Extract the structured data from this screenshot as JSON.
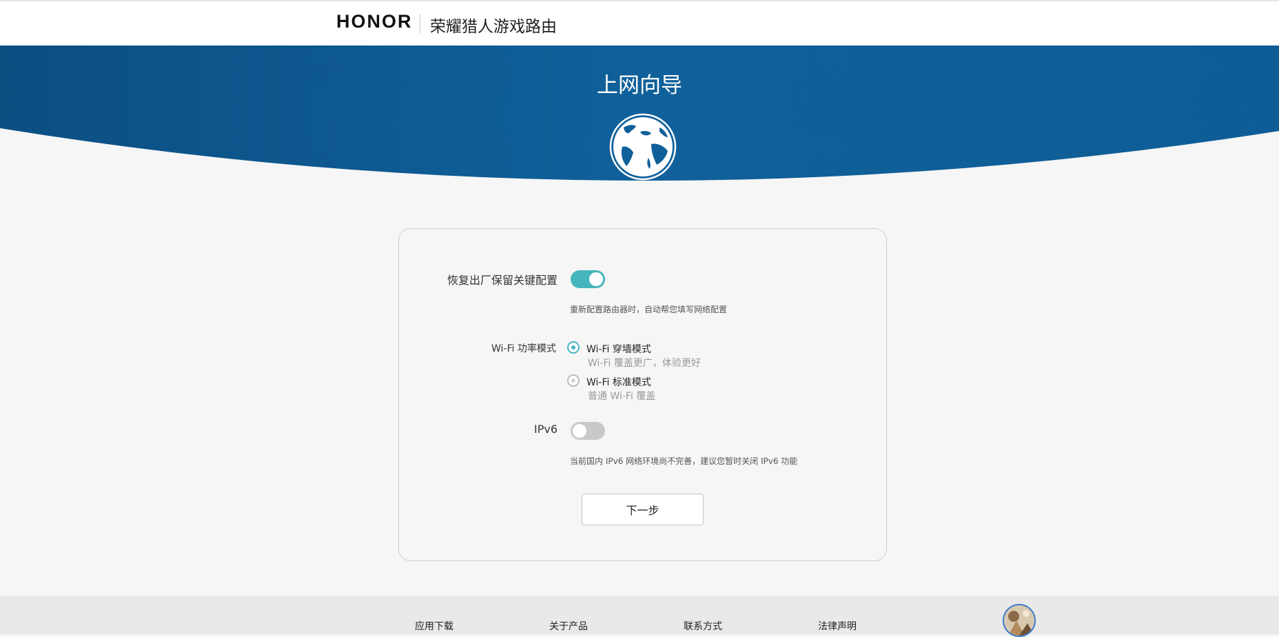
{
  "header": {
    "brand": "HONOR",
    "product": "荣耀猎人游戏路由"
  },
  "banner": {
    "title": "上网向导",
    "icon": "globe-icon"
  },
  "form": {
    "restore": {
      "label": "恢复出厂保留关键配置",
      "enabled": true,
      "hint": "重新配置路由器时，自动帮您填写网络配置"
    },
    "wifi_mode": {
      "label": "Wi-Fi 功率模式",
      "options": [
        {
          "title": "Wi-Fi 穿墙模式",
          "subtitle": "Wi-Fi 覆盖更广，体验更好",
          "selected": true
        },
        {
          "title": "Wi-Fi 标准模式",
          "subtitle": "普通 Wi-Fi 覆盖",
          "selected": false
        }
      ]
    },
    "ipv6": {
      "label": "IPv6",
      "enabled": false,
      "hint": "当前国内 IPv6 网络环境尚不完善，建议您暂时关闭 IPv6 功能"
    },
    "next_label": "下一步"
  },
  "footer": {
    "links": [
      "应用下载",
      "关于产品",
      "联系方式",
      "法律声明"
    ]
  },
  "colors": {
    "accent": "#45b6bc",
    "banner": "#0e5e98"
  }
}
